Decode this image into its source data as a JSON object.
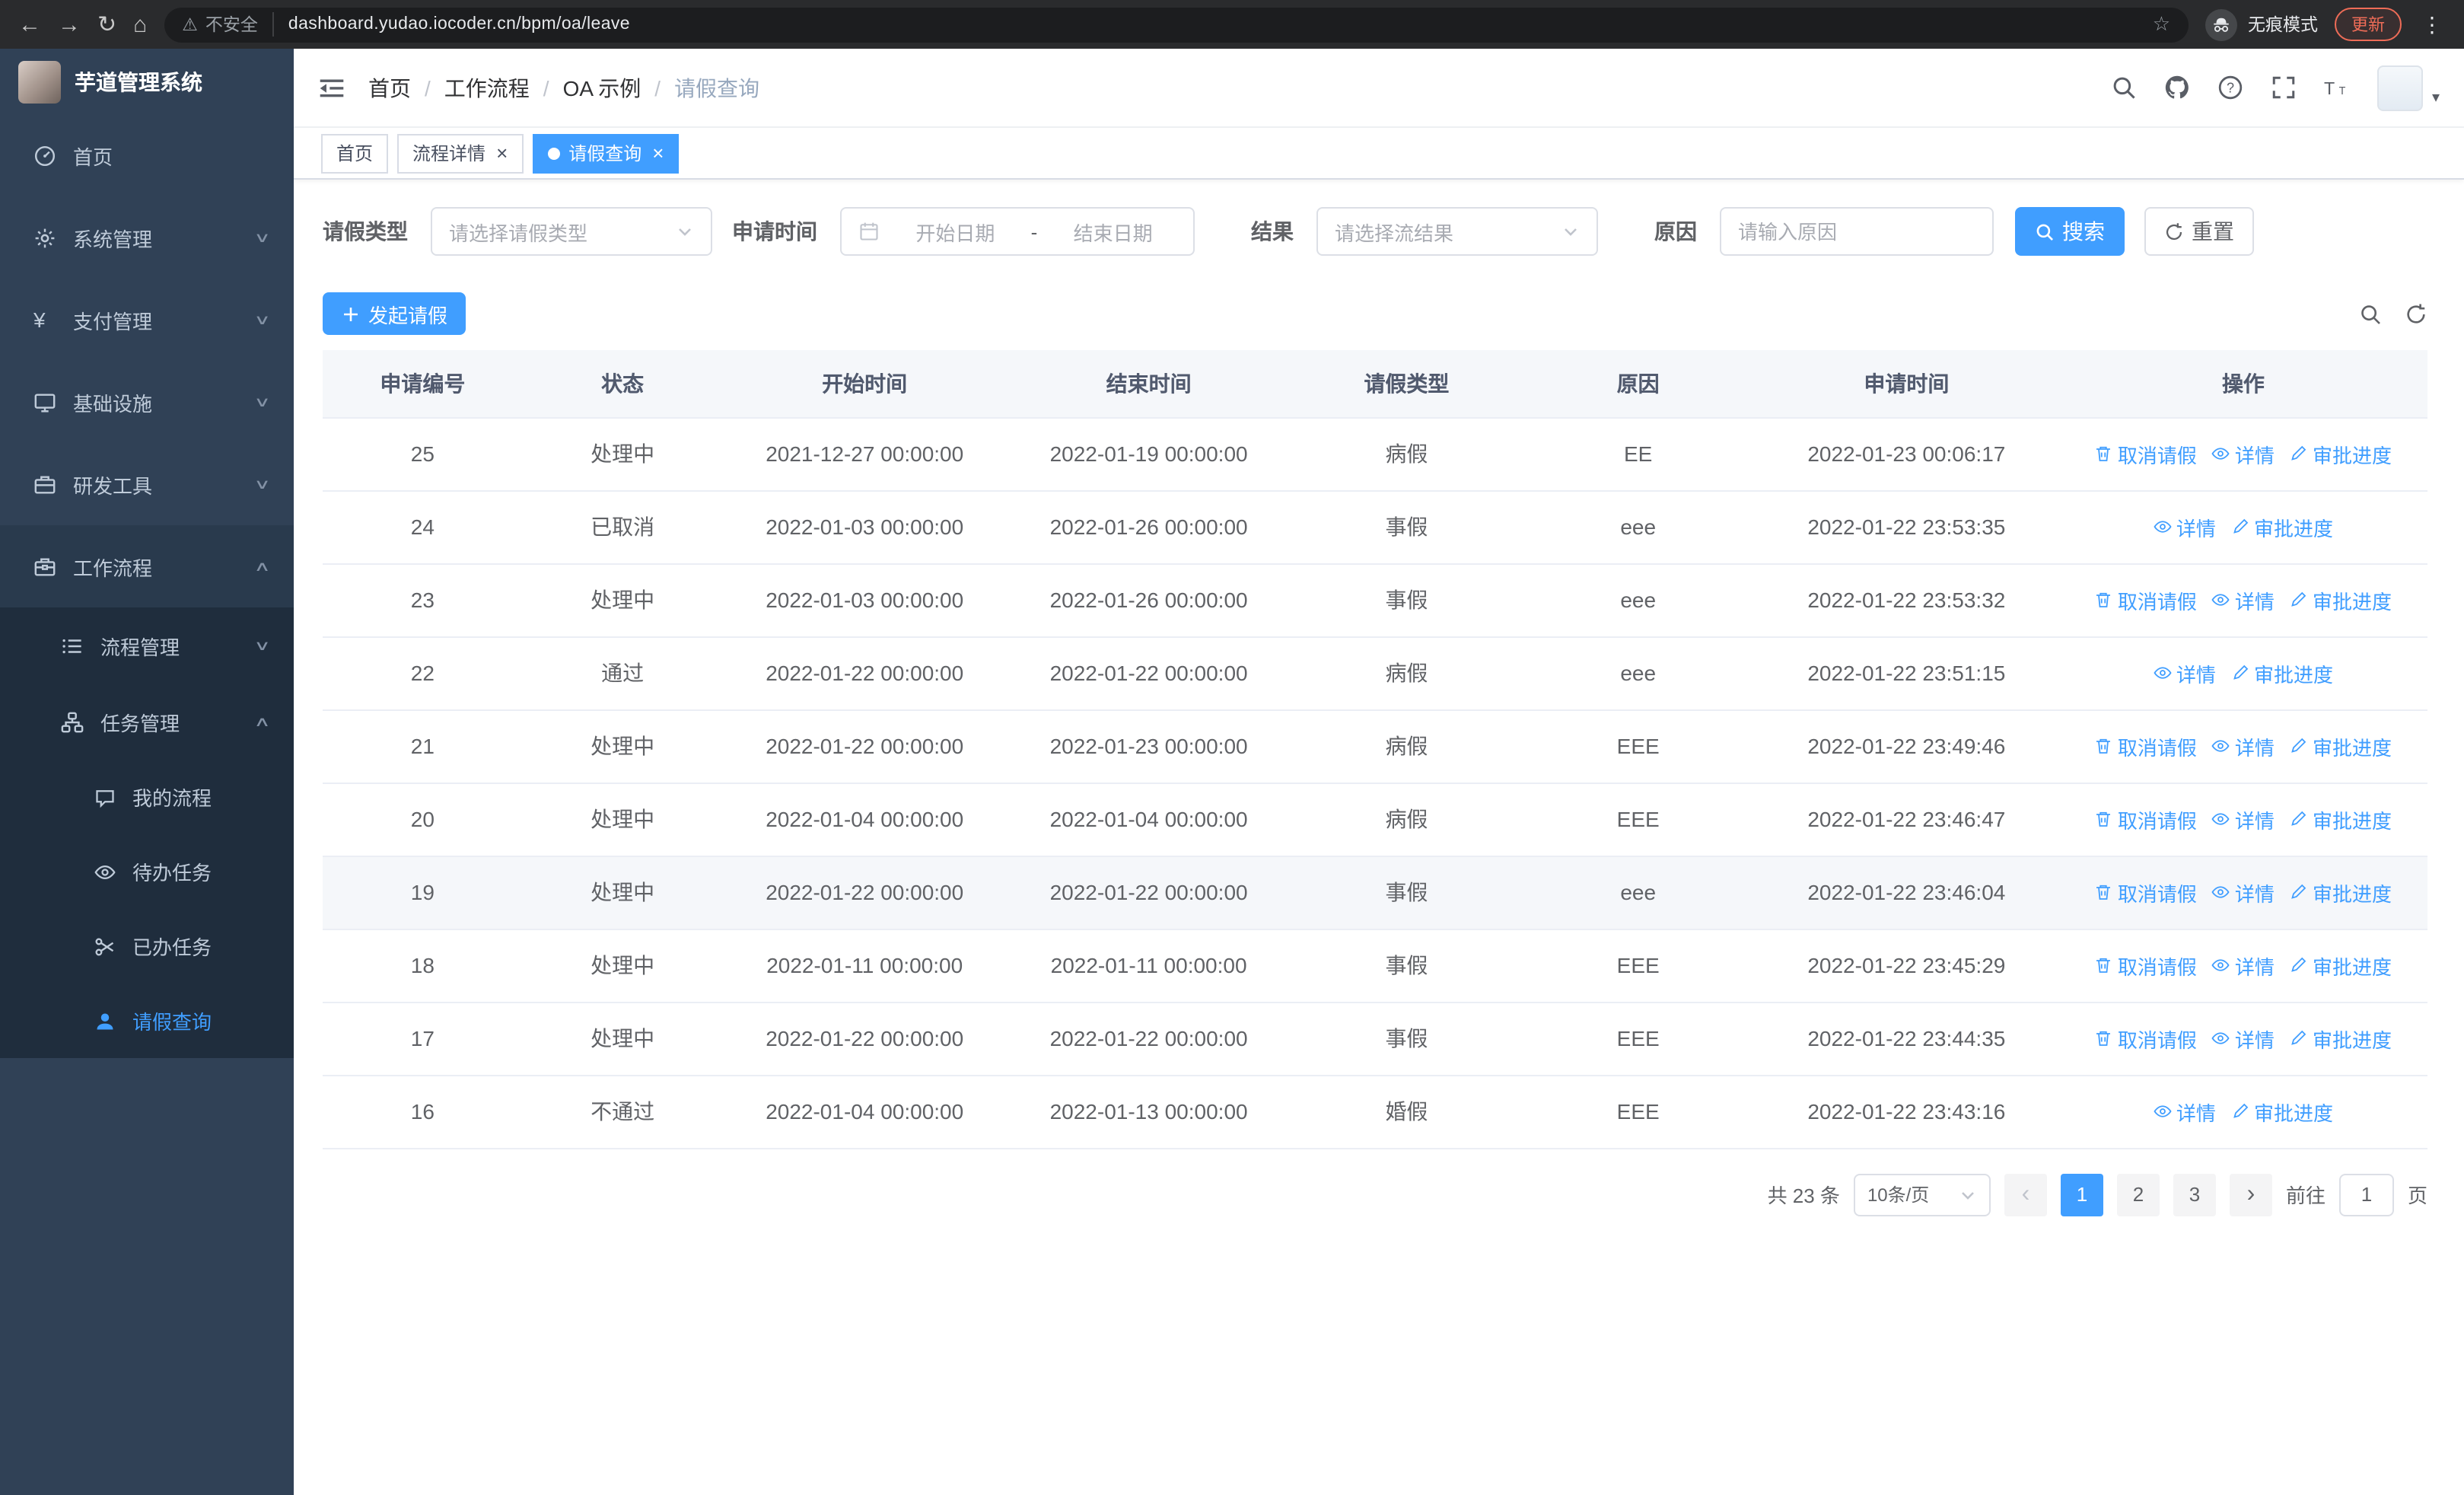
{
  "colors": {
    "primary": "#409eff",
    "sidebar_bg": "#304156",
    "submenu_bg": "#1f2d3d",
    "sidebar_text": "#bfcbd9",
    "table_header_bg": "#f5f7fa",
    "table_border": "#ebeef5",
    "update_accent": "#ee6c57"
  },
  "browser": {
    "security_warning": "不安全",
    "url": "dashboard.yudao.iocoder.cn/bpm/oa/leave",
    "incognito_label": "无痕模式",
    "update_label": "更新"
  },
  "icons": {
    "back": "←",
    "forward": "→",
    "reload": "↻",
    "home": "⌂",
    "star": "☆",
    "warning": "⚠",
    "menu_dots": "⋮",
    "caret_down": "▾",
    "breadcrumb_sep": "/",
    "close": "×",
    "chevron_down": "∨",
    "chevron_up": "∧",
    "yen": "¥",
    "prev": "‹",
    "next": "›"
  },
  "sidebar": {
    "app_title": "芋道管理系统",
    "menu": [
      {
        "label": "首页",
        "icon": "dashboard-icon"
      },
      {
        "label": "系统管理",
        "icon": "gear-icon",
        "arrow": "down"
      },
      {
        "label": "支付管理",
        "icon": "yen-icon",
        "arrow": "down"
      },
      {
        "label": "基础设施",
        "icon": "monitor-icon",
        "arrow": "down"
      },
      {
        "label": "研发工具",
        "icon": "toolbox-icon",
        "arrow": "down"
      },
      {
        "label": "工作流程",
        "icon": "briefcase-icon",
        "arrow": "up",
        "expanded": true
      }
    ],
    "submenu": [
      {
        "label": "流程管理",
        "icon": "list-icon",
        "arrow": "down"
      },
      {
        "label": "任务管理",
        "icon": "org-icon",
        "arrow": "up",
        "expanded": true
      }
    ],
    "task_items": [
      {
        "label": "我的流程",
        "icon": "chat-icon"
      },
      {
        "label": "待办任务",
        "icon": "eye-icon"
      },
      {
        "label": "已办任务",
        "icon": "scissors-icon"
      },
      {
        "label": "请假查询",
        "icon": "user-icon",
        "active": true
      }
    ]
  },
  "topbar": {
    "breadcrumb": [
      "首页",
      "工作流程",
      "OA 示例",
      "请假查询"
    ]
  },
  "tabs": [
    {
      "label": "首页",
      "closable": false,
      "active": false
    },
    {
      "label": "流程详情",
      "closable": true,
      "active": false
    },
    {
      "label": "请假查询",
      "closable": true,
      "active": true
    }
  ],
  "filters": {
    "leave_type_label": "请假类型",
    "leave_type_placeholder": "请选择请假类型",
    "apply_time_label": "申请时间",
    "start_placeholder": "开始日期",
    "range_separator": "-",
    "end_placeholder": "结束日期",
    "result_label": "结果",
    "result_placeholder": "请选择流结果",
    "reason_label": "原因",
    "reason_placeholder": "请输入原因",
    "search_label": "搜索",
    "reset_label": "重置"
  },
  "toolbar": {
    "create_label": "发起请假"
  },
  "table": {
    "columns": [
      "申请编号",
      "状态",
      "开始时间",
      "结束时间",
      "请假类型",
      "原因",
      "申请时间",
      "操作"
    ],
    "action_defs": {
      "cancel": {
        "label": "取消请假",
        "icon": "delete-icon"
      },
      "detail": {
        "label": "详情",
        "icon": "eye-icon"
      },
      "progress": {
        "label": "审批进度",
        "icon": "edit-icon"
      }
    },
    "rows": [
      {
        "id": "25",
        "status": "处理中",
        "start": "2021-12-27 00:00:00",
        "end": "2022-01-19 00:00:00",
        "type": "病假",
        "reason": "EE",
        "apply_time": "2022-01-23 00:06:17",
        "actions": [
          "cancel",
          "detail",
          "progress"
        ],
        "highlighted": false
      },
      {
        "id": "24",
        "status": "已取消",
        "start": "2022-01-03 00:00:00",
        "end": "2022-01-26 00:00:00",
        "type": "事假",
        "reason": "eee",
        "apply_time": "2022-01-22 23:53:35",
        "actions": [
          "detail",
          "progress"
        ],
        "highlighted": false
      },
      {
        "id": "23",
        "status": "处理中",
        "start": "2022-01-03 00:00:00",
        "end": "2022-01-26 00:00:00",
        "type": "事假",
        "reason": "eee",
        "apply_time": "2022-01-22 23:53:32",
        "actions": [
          "cancel",
          "detail",
          "progress"
        ],
        "highlighted": false
      },
      {
        "id": "22",
        "status": "通过",
        "start": "2022-01-22 00:00:00",
        "end": "2022-01-22 00:00:00",
        "type": "病假",
        "reason": "eee",
        "apply_time": "2022-01-22 23:51:15",
        "actions": [
          "detail",
          "progress"
        ],
        "highlighted": false
      },
      {
        "id": "21",
        "status": "处理中",
        "start": "2022-01-22 00:00:00",
        "end": "2022-01-23 00:00:00",
        "type": "病假",
        "reason": "EEE",
        "apply_time": "2022-01-22 23:49:46",
        "actions": [
          "cancel",
          "detail",
          "progress"
        ],
        "highlighted": false
      },
      {
        "id": "20",
        "status": "处理中",
        "start": "2022-01-04 00:00:00",
        "end": "2022-01-04 00:00:00",
        "type": "病假",
        "reason": "EEE",
        "apply_time": "2022-01-22 23:46:47",
        "actions": [
          "cancel",
          "detail",
          "progress"
        ],
        "highlighted": false
      },
      {
        "id": "19",
        "status": "处理中",
        "start": "2022-01-22 00:00:00",
        "end": "2022-01-22 00:00:00",
        "type": "事假",
        "reason": "eee",
        "apply_time": "2022-01-22 23:46:04",
        "actions": [
          "cancel",
          "detail",
          "progress"
        ],
        "highlighted": true
      },
      {
        "id": "18",
        "status": "处理中",
        "start": "2022-01-11 00:00:00",
        "end": "2022-01-11 00:00:00",
        "type": "事假",
        "reason": "EEE",
        "apply_time": "2022-01-22 23:45:29",
        "actions": [
          "cancel",
          "detail",
          "progress"
        ],
        "highlighted": false
      },
      {
        "id": "17",
        "status": "处理中",
        "start": "2022-01-22 00:00:00",
        "end": "2022-01-22 00:00:00",
        "type": "事假",
        "reason": "EEE",
        "apply_time": "2022-01-22 23:44:35",
        "actions": [
          "cancel",
          "detail",
          "progress"
        ],
        "highlighted": false
      },
      {
        "id": "16",
        "status": "不通过",
        "start": "2022-01-04 00:00:00",
        "end": "2022-01-13 00:00:00",
        "type": "婚假",
        "reason": "EEE",
        "apply_time": "2022-01-22 23:43:16",
        "actions": [
          "detail",
          "progress"
        ],
        "highlighted": false
      }
    ]
  },
  "pagination": {
    "total_label": "共 23 条",
    "page_size_label": "10条/页",
    "pages": [
      "1",
      "2",
      "3"
    ],
    "active_page": "1",
    "goto_label": "前往",
    "goto_value": "1",
    "page_unit_label": "页"
  }
}
